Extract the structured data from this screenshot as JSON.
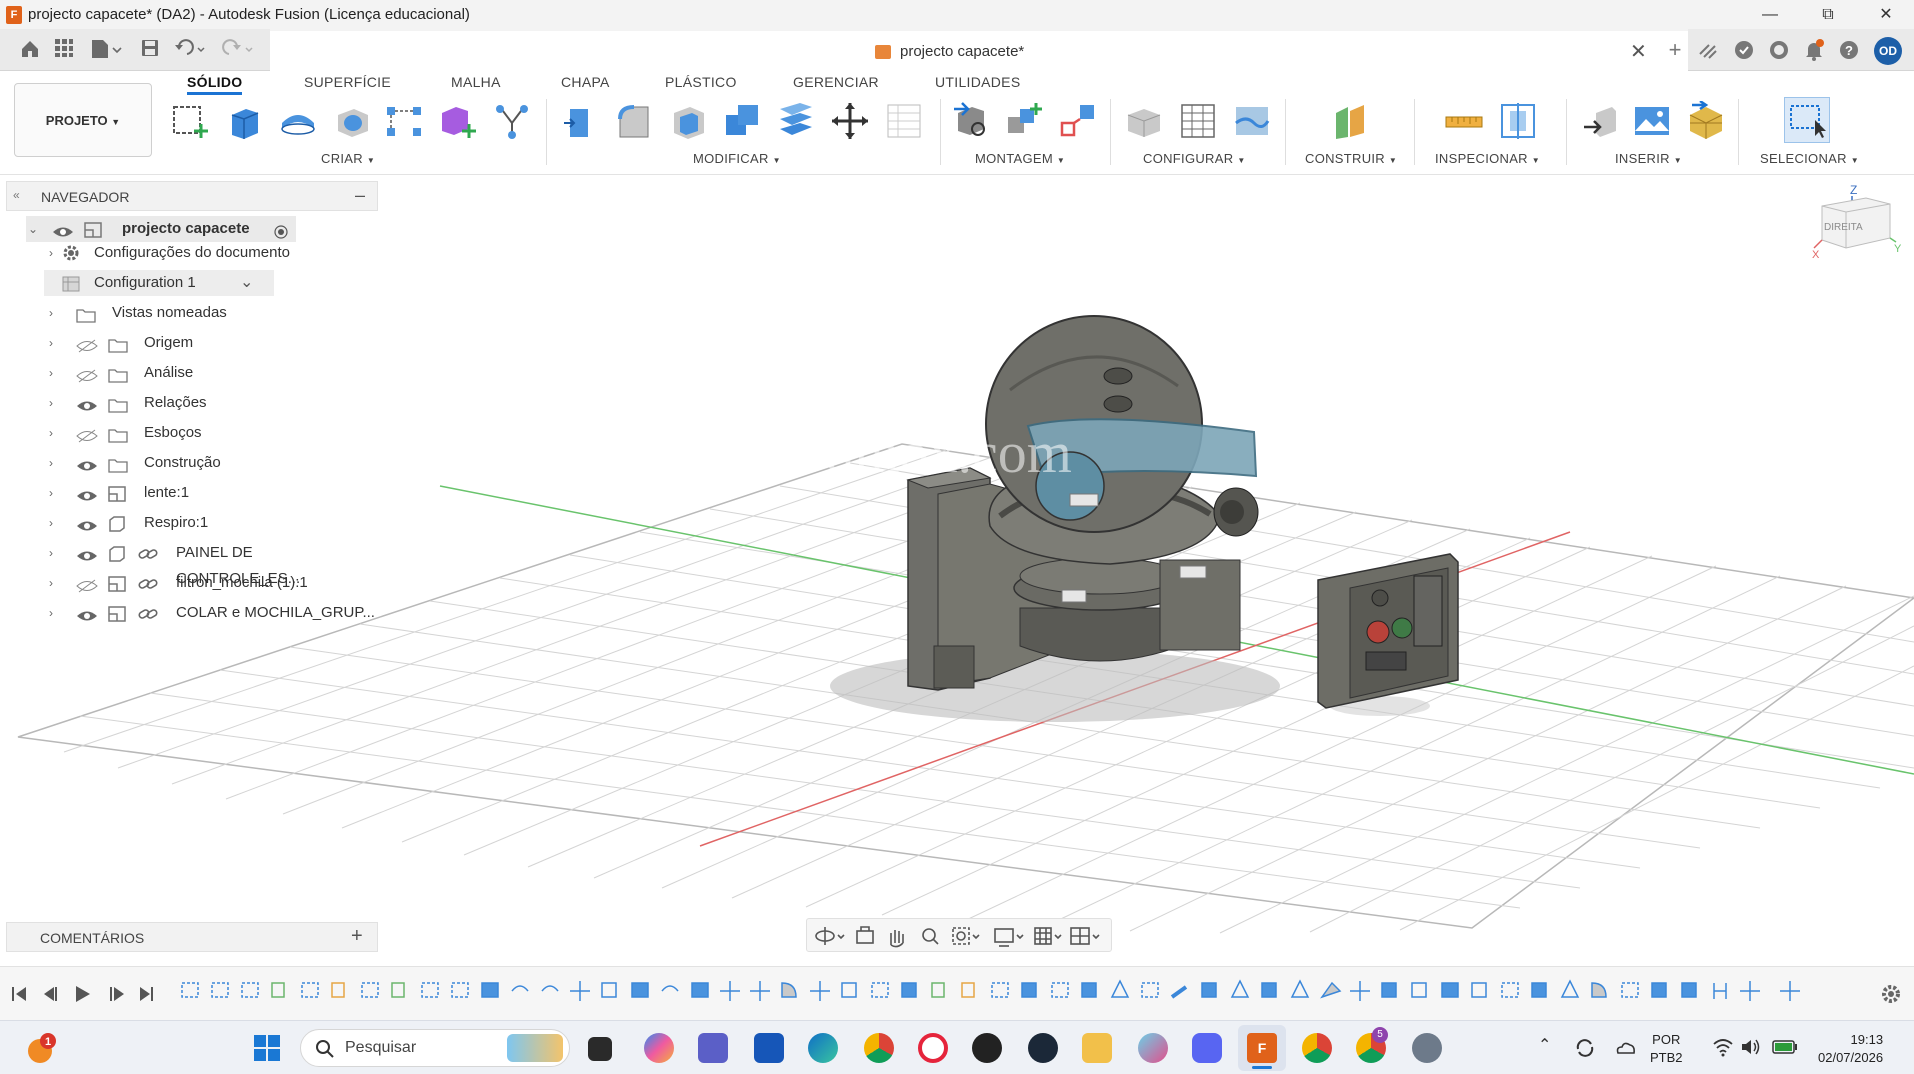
{
  "window": {
    "title": "projecto capacete* (DA2) - Autodesk Fusion (Licença educacional)",
    "app_icon_letter": "F"
  },
  "tabbar": {
    "document_tab": "projecto capacete*",
    "user_initials": "OD"
  },
  "ribbon": {
    "project_button": "PROJETO",
    "tabs": [
      {
        "label": "SÓLIDO",
        "active": true
      },
      {
        "label": "SUPERFÍCIE",
        "active": false
      },
      {
        "label": "MALHA",
        "active": false
      },
      {
        "label": "CHAPA",
        "active": false
      },
      {
        "label": "PLÁSTICO",
        "active": false
      },
      {
        "label": "GERENCIAR",
        "active": false
      },
      {
        "label": "UTILIDADES",
        "active": false
      }
    ],
    "groups": {
      "criar": "CRIAR",
      "modificar": "MODIFICAR",
      "montagem": "MONTAGEM",
      "configurar": "CONFIGURAR",
      "construir": "CONSTRUIR",
      "inspecionar": "INSPECIONAR",
      "inserir": "INSERIR",
      "selecionar": "SELECIONAR"
    }
  },
  "navigator": {
    "title": "NAVEGADOR",
    "root": "projecto capacete",
    "items": [
      {
        "label": "Configurações do documento"
      },
      {
        "label": "Configuration 1"
      },
      {
        "label": "Vistas nomeadas"
      },
      {
        "label": "Origem"
      },
      {
        "label": "Análise"
      },
      {
        "label": "Relações"
      },
      {
        "label": "Esboços"
      },
      {
        "label": "Construção"
      },
      {
        "label": "lente:1"
      },
      {
        "label": "Respiro:1"
      },
      {
        "label": "PAINEL DE CONTROLE_ES..."
      },
      {
        "label": "filtron_mochila (1):1"
      },
      {
        "label": "COLAR e MOCHILA_GRUP..."
      }
    ]
  },
  "viewcube": {
    "face_label": "DIREITA",
    "axis_z": "Z",
    "axis_x": "X",
    "axis_y": "Y"
  },
  "viewport": {
    "watermark": "www.3dmox.com"
  },
  "comments": {
    "title": "COMENTÁRIOS"
  },
  "taskbar": {
    "search_placeholder": "Pesquisar",
    "notification_count": "1",
    "lang_line1": "POR",
    "lang_line2": "PTB2",
    "time": "19:13",
    "date": "02/07/2026",
    "chrome_badge": "5"
  },
  "colors": {
    "accent": "#1b73d3",
    "fusion_orange": "#e0621a",
    "grid_line": "#c9c9c9",
    "axis_red": "#e06464",
    "axis_green": "#69c36c"
  }
}
